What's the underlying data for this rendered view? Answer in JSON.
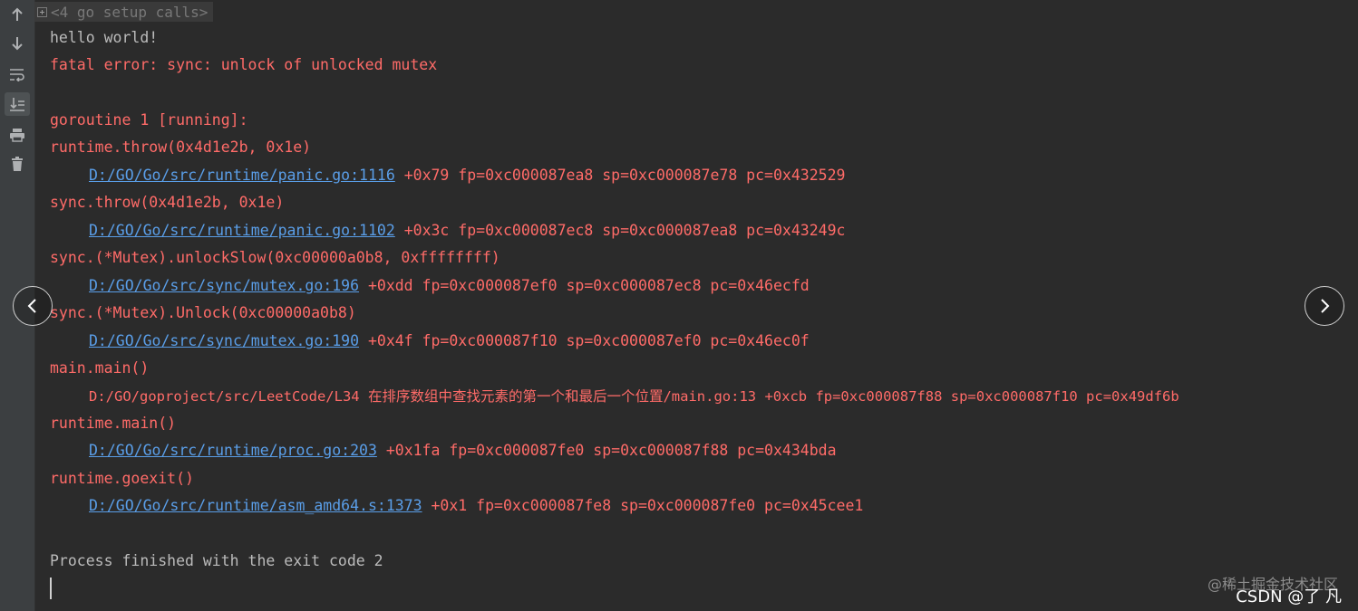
{
  "toolbar": {
    "icons": [
      "up-arrow-icon",
      "down-arrow-icon",
      "soft-wrap-icon",
      "scroll-to-end-icon",
      "print-icon",
      "trash-icon"
    ]
  },
  "console": {
    "folded_label": "<4 go setup calls>",
    "lines": [
      "hello world!",
      "fatal error: sync: unlock of unlocked mutex",
      "",
      "goroutine 1 [running]:",
      "runtime.throw(0x4d1e2b, 0x1e)",
      "D:/GO/Go/src/runtime/panic.go:1116",
      " +0x79 fp=0xc000087ea8 sp=0xc000087e78 pc=0x432529",
      "sync.throw(0x4d1e2b, 0x1e)",
      "D:/GO/Go/src/runtime/panic.go:1102",
      " +0x3c fp=0xc000087ec8 sp=0xc000087ea8 pc=0x43249c",
      "sync.(*Mutex).unlockSlow(0xc00000a0b8, 0xffffffff)",
      "D:/GO/Go/src/sync/mutex.go:196",
      " +0xdd fp=0xc000087ef0 sp=0xc000087ec8 pc=0x46ecfd",
      "sync.(*Mutex).Unlock(0xc00000a0b8)",
      "D:/GO/Go/src/sync/mutex.go:190",
      " +0x4f fp=0xc000087f10 sp=0xc000087ef0 pc=0x46ec0f",
      "main.main()",
      "D:/GO/goproject/src/LeetCode/L34 ",
      "在排序数组中查找元素的第一个和最后一个位置",
      "/main.go:13 +0xcb fp=0xc000087f88 sp=0xc000087f10 pc=0x49df6b",
      "runtime.main()",
      "D:/GO/Go/src/runtime/proc.go:203",
      " +0x1fa fp=0xc000087fe0 sp=0xc000087f88 pc=0x434bda",
      "runtime.goexit()",
      "D:/GO/Go/src/runtime/asm_amd64.s:1373",
      " +0x1 fp=0xc000087fe8 sp=0xc000087fe0 pc=0x45cee1",
      "Process finished with the exit code 2"
    ]
  },
  "watermark": {
    "line1": "@稀土掘金技术社区",
    "line2": "CSDN @了 凡"
  },
  "colors": {
    "background": "#2b2b2b",
    "error": "#ff6b68",
    "link": "#5a9ee8",
    "normal": "#bbbbbb"
  }
}
